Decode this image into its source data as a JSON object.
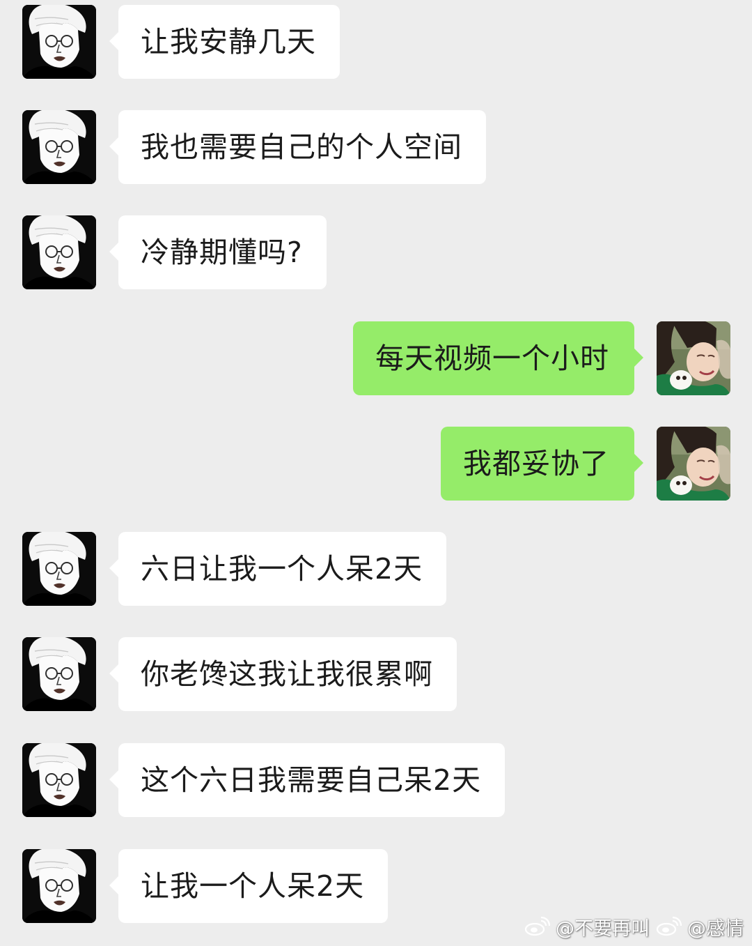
{
  "messages": [
    {
      "side": "left",
      "text": "让我安静几天"
    },
    {
      "side": "left",
      "text": "我也需要自己的个人空间"
    },
    {
      "side": "left",
      "text": "冷静期懂吗?"
    },
    {
      "side": "right",
      "text": "每天视频一个小时"
    },
    {
      "side": "right",
      "text": "我都妥协了"
    },
    {
      "side": "left",
      "text": "六日让我一个人呆2天"
    },
    {
      "side": "left",
      "text": "你老馋这我让我很累啊"
    },
    {
      "side": "left",
      "text": "这个六日我需要自己呆2天"
    },
    {
      "side": "left",
      "text": "让我一个人呆2天"
    }
  ],
  "watermark": {
    "handle_1": "@不要再叫",
    "handle_2": "@感情"
  },
  "colors": {
    "background": "#ededed",
    "incoming_bubble": "#ffffff",
    "outgoing_bubble": "#95ec69"
  },
  "icons": {
    "incoming_avatar": "sketch-portrait-avatar",
    "outgoing_avatar": "photo-portrait-avatar",
    "watermark_logo": "weibo-logo-icon"
  }
}
